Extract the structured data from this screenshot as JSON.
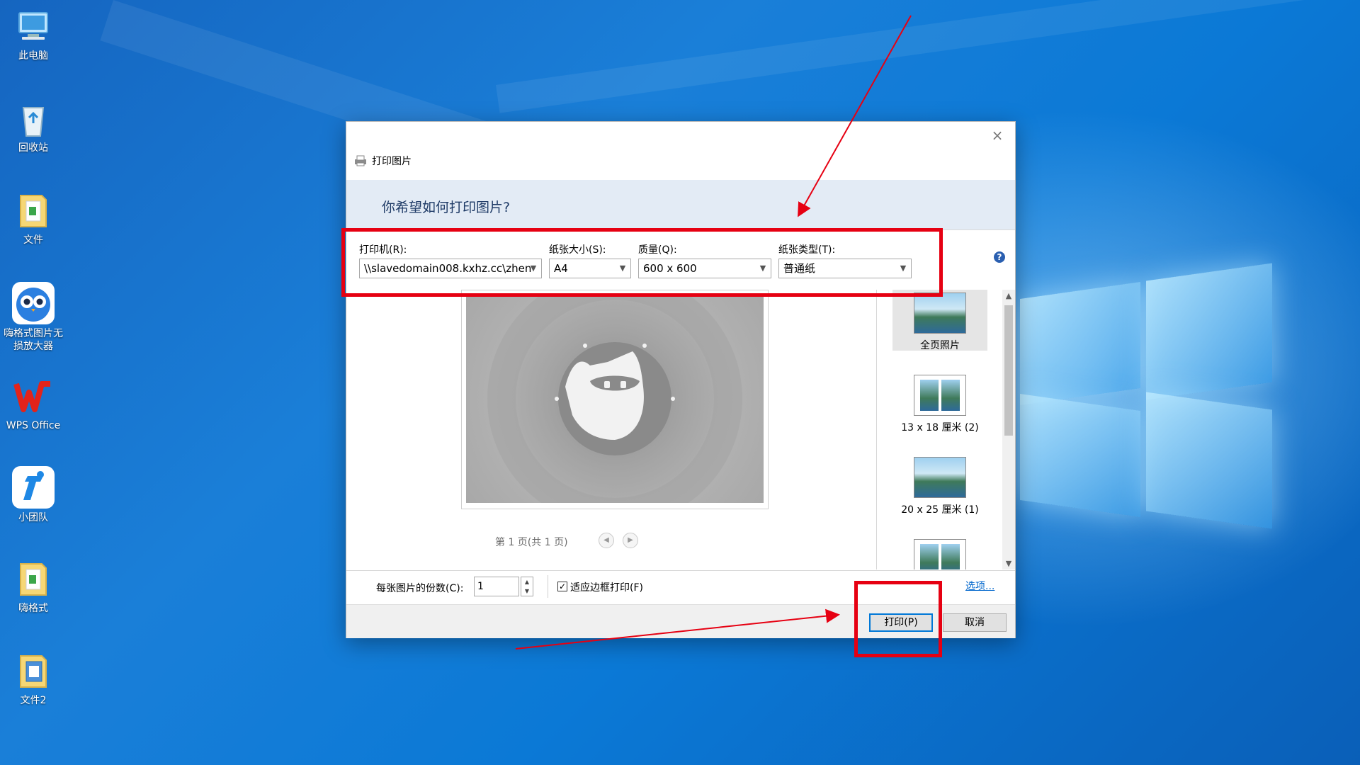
{
  "desktop": {
    "icons": [
      {
        "label": "此电脑",
        "icon": "computer-icon"
      },
      {
        "label": "回收站",
        "icon": "recycle-bin-icon"
      },
      {
        "label": "文件",
        "icon": "folder-icon"
      },
      {
        "label": "嗨格式图片无损放大器",
        "icon": "owl-app-icon"
      },
      {
        "label": "WPS Office",
        "icon": "wps-office-icon"
      },
      {
        "label": "小团队",
        "icon": "team-app-icon"
      },
      {
        "label": "嗨格式",
        "icon": "folder-icon"
      },
      {
        "label": "文件2",
        "icon": "folder-icon"
      }
    ]
  },
  "dialog": {
    "title": "打印图片",
    "question": "你希望如何打印图片?",
    "close_symbol": "×",
    "help_symbol": "?",
    "printer": {
      "label": "打印机(R):",
      "value": "\\\\slavedomain008.kxhz.cc\\zhen"
    },
    "paper_size": {
      "label": "纸张大小(S):",
      "value": "A4"
    },
    "quality": {
      "label": "质量(Q):",
      "value": "600 x 600"
    },
    "paper_type": {
      "label": "纸张类型(T):",
      "value": "普通纸"
    },
    "page_indicator": "第 1 页(共 1 页)",
    "layouts": [
      {
        "label": "全页照片",
        "selected": true
      },
      {
        "label": "13 x 18 厘米 (2)",
        "selected": false
      },
      {
        "label": "20 x 25 厘米 (1)",
        "selected": false
      }
    ],
    "copies_label": "每张图片的份数(C):",
    "copies_value": "1",
    "fit_label": "适应边框打印(F)",
    "fit_checked": true,
    "options_link": "选项...",
    "print_button": "打印(P)",
    "cancel_button": "取消"
  },
  "colors": {
    "annotation_red": "#e60012",
    "desktop_blue": "#1a7fd8",
    "header_band": "#e3ebf5"
  }
}
